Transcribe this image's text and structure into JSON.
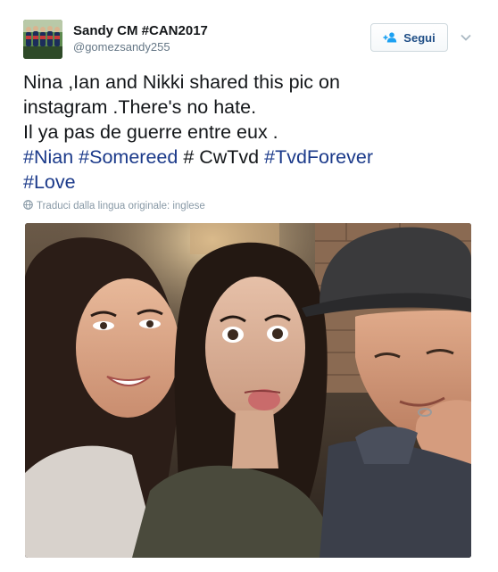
{
  "user": {
    "display_name": "Sandy CM #CAN2017",
    "screen_name": "@gomezsandy255"
  },
  "follow_button": {
    "label": "Segui",
    "icon": "add-user-icon"
  },
  "more_button": {
    "icon": "chevron-down-icon"
  },
  "tweet": {
    "line1": "Nina ,Ian and Nikki shared this pic on",
    "line2": "instagram .There's no hate.",
    "line3": "Il ya pas de guerre entre eux .",
    "line4": {
      "h1": "#Nian",
      "h2": "#Somereed",
      "plain": "# CwTvd",
      "h3": "#TvdForever"
    },
    "line5": {
      "h4": "#Love"
    },
    "hashtag_color": "#1b3a8a"
  },
  "translate": {
    "icon": "globe-icon",
    "label": "Traduci dalla lingua originale: inglese"
  },
  "media": {
    "icon": "photo"
  }
}
